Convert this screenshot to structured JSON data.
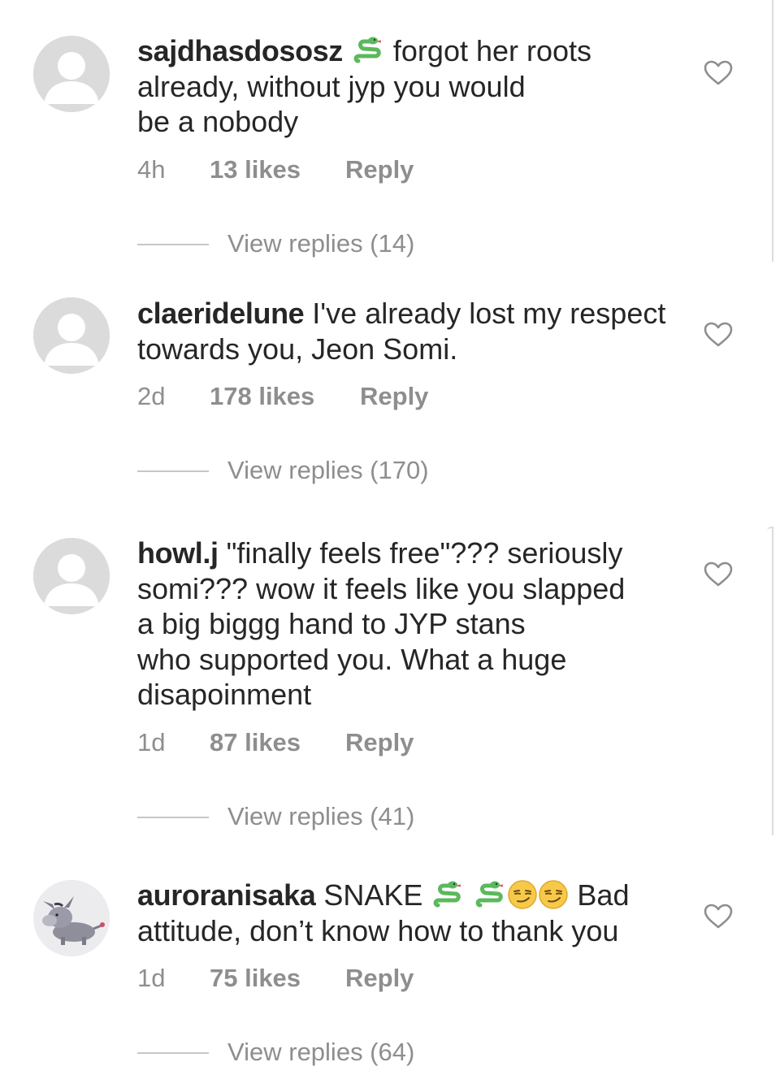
{
  "comments": [
    {
      "username": "sajdhasdososz",
      "text_after_emoji": " forgot her roots",
      "text_line2": "already, without jyp you would",
      "text_line3": "be a nobody",
      "time": "4h",
      "likes": "13 likes",
      "reply": "Reply",
      "view_replies": "View replies (14)"
    },
    {
      "username": "claeridelune",
      "text_line1": " I've already lost my respect",
      "text_line2": "towards you, Jeon Somi.",
      "time": "2d",
      "likes": "178 likes",
      "reply": "Reply",
      "view_replies": "View replies (170)"
    },
    {
      "username": "howl.j",
      "text_line1": " \"finally feels free\"??? seriously",
      "text_line2": "somi??? wow it feels like you slapped",
      "text_line3": "a big biggg hand to JYP stans",
      "text_line4": "who supported you. What a huge",
      "text_line5": "disapoinment",
      "time": "1d",
      "likes": "87 likes",
      "reply": "Reply",
      "view_replies": "View replies (41)"
    },
    {
      "username": "auroranisaka",
      "text_before_emoji": " SNAKE ",
      "text_after_emoji": " Bad",
      "text_line2": "attitude, don’t know how to thank you",
      "time": "1d",
      "likes": "75 likes",
      "reply": "Reply",
      "view_replies": "View replies (64)"
    }
  ],
  "icons": {
    "avatar_placeholder": "default-avatar-icon",
    "avatar_photo": "donkey-avatar-image",
    "like": "heart-outline-icon",
    "snake": "snake-emoji",
    "smirk": "smirking-face-emoji"
  },
  "colors": {
    "text": "#262626",
    "secondary": "#8e8e8e",
    "avatar_bg": "#dbdbdb"
  }
}
